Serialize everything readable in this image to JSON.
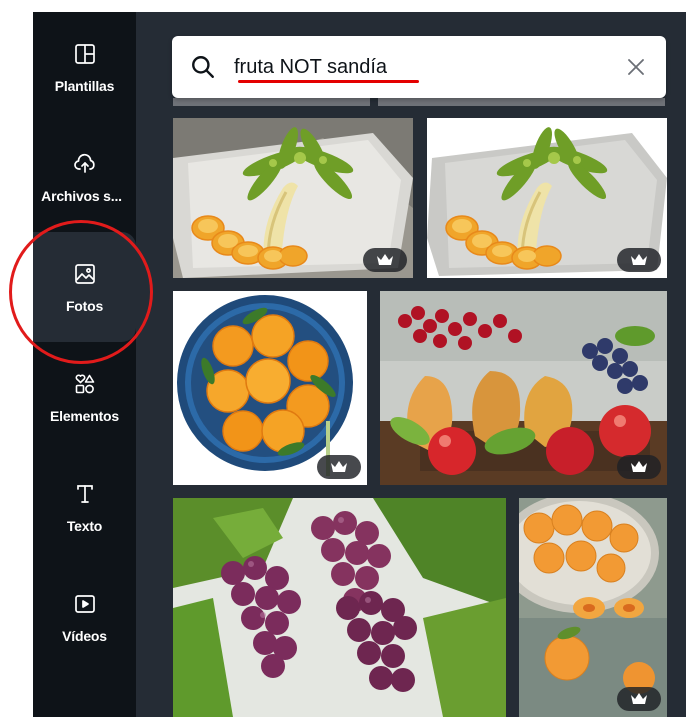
{
  "sidebar": {
    "items": [
      {
        "label": "Plantillas",
        "icon": "template-icon",
        "active": false
      },
      {
        "label": "Archivos s...",
        "icon": "cloud-upload-icon",
        "active": false
      },
      {
        "label": "Fotos",
        "icon": "image-icon",
        "active": true
      },
      {
        "label": "Elementos",
        "icon": "shapes-icon",
        "active": false
      },
      {
        "label": "Texto",
        "icon": "text-icon",
        "active": false
      },
      {
        "label": "Vídeos",
        "icon": "video-icon",
        "active": false
      }
    ]
  },
  "search": {
    "query": "fruta NOT sandía",
    "placeholder": ""
  },
  "photos": [
    {
      "subject": "kiwi-banana-palm-tree",
      "premium": true
    },
    {
      "subject": "kiwi-banana-palm-tree-white",
      "premium": true
    },
    {
      "subject": "tangerines-bowl",
      "premium": true
    },
    {
      "subject": "pears-apples-berries",
      "premium": true
    },
    {
      "subject": "grapes",
      "premium": false
    },
    {
      "subject": "apricots",
      "premium": true
    }
  ],
  "colors": {
    "rail_bg": "#0e1318",
    "panel_bg": "#252c35",
    "annotation": "#e11b1b"
  }
}
